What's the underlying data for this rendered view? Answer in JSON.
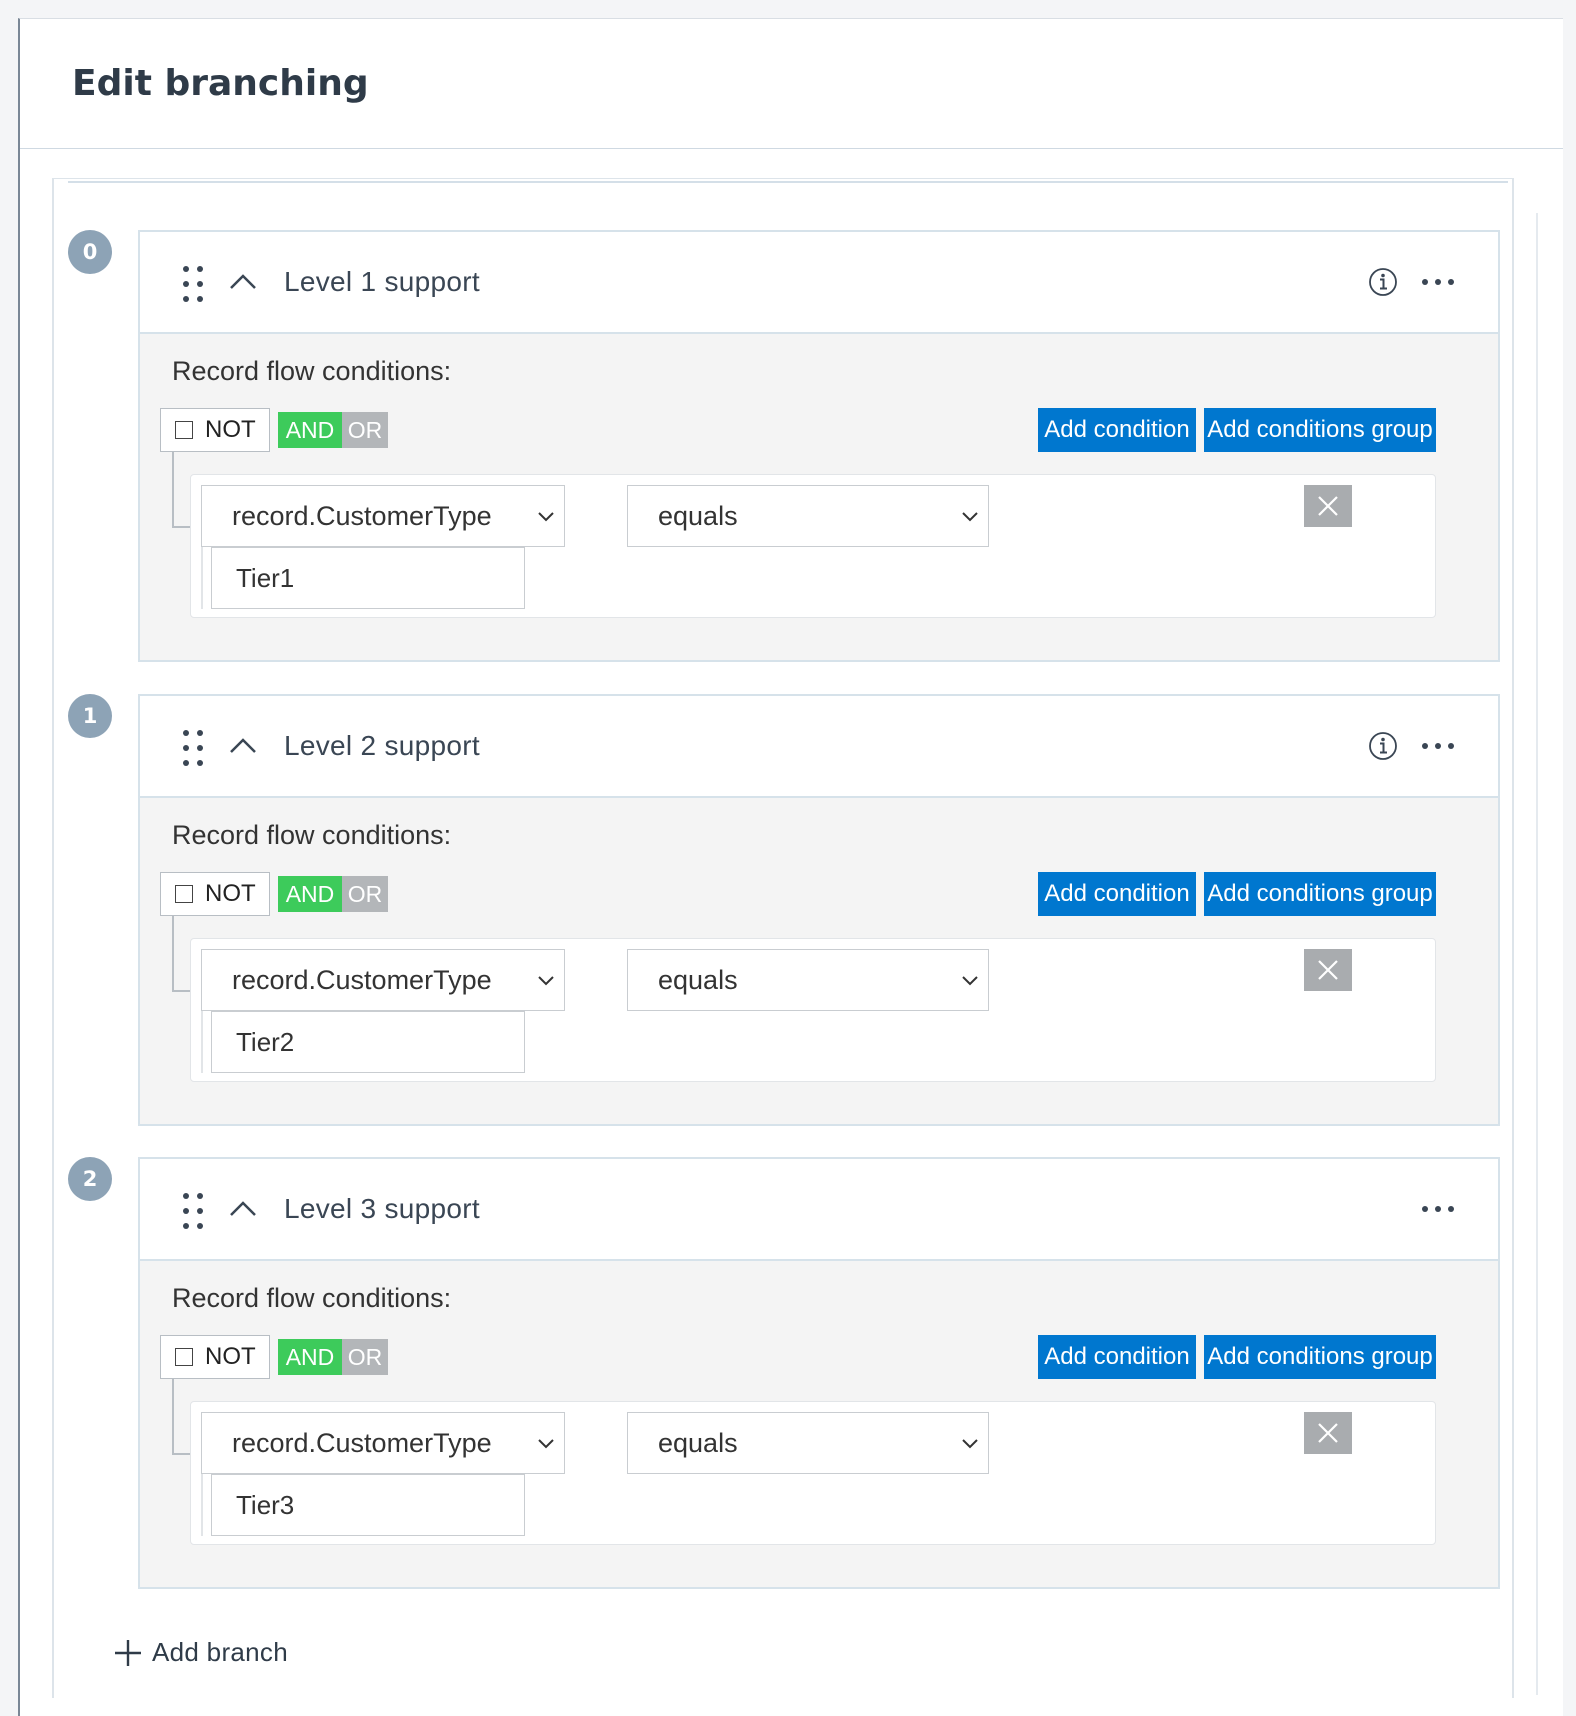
{
  "header": {
    "title": "Edit branching"
  },
  "branches": [
    {
      "index": "0",
      "name": "Level 1 support",
      "has_info": true,
      "conditions_label": "Record flow conditions:",
      "not_label": "NOT",
      "and_label": "AND",
      "or_label": "OR",
      "add_condition_label": "Add condition",
      "add_group_label": "Add conditions group",
      "condition": {
        "field": "record.CustomerType",
        "operator": "equals",
        "value": "Tier1"
      }
    },
    {
      "index": "1",
      "name": "Level 2 support",
      "has_info": true,
      "conditions_label": "Record flow conditions:",
      "not_label": "NOT",
      "and_label": "AND",
      "or_label": "OR",
      "add_condition_label": "Add condition",
      "add_group_label": "Add conditions group",
      "condition": {
        "field": "record.CustomerType",
        "operator": "equals",
        "value": "Tier2"
      }
    },
    {
      "index": "2",
      "name": "Level 3 support",
      "has_info": false,
      "conditions_label": "Record flow conditions:",
      "not_label": "NOT",
      "and_label": "AND",
      "or_label": "OR",
      "add_condition_label": "Add condition",
      "add_group_label": "Add conditions group",
      "condition": {
        "field": "record.CustomerType",
        "operator": "equals",
        "value": "Tier3"
      }
    }
  ],
  "footer": {
    "add_branch_label": "Add branch"
  },
  "icons": {
    "drag": "drag-handle-icon",
    "collapse": "chevron-up-icon",
    "info": "info-icon",
    "more": "more-horizontal-icon",
    "checkbox": "checkbox-icon",
    "select": "chevron-down-icon",
    "remove": "close-icon",
    "add": "plus-icon"
  },
  "colors": {
    "primary": "#0077cf",
    "and_active": "#3dcb5b",
    "or_inactive": "#b3b6b9",
    "index_badge": "#8da3b6",
    "remove_button": "#a9acaf"
  }
}
